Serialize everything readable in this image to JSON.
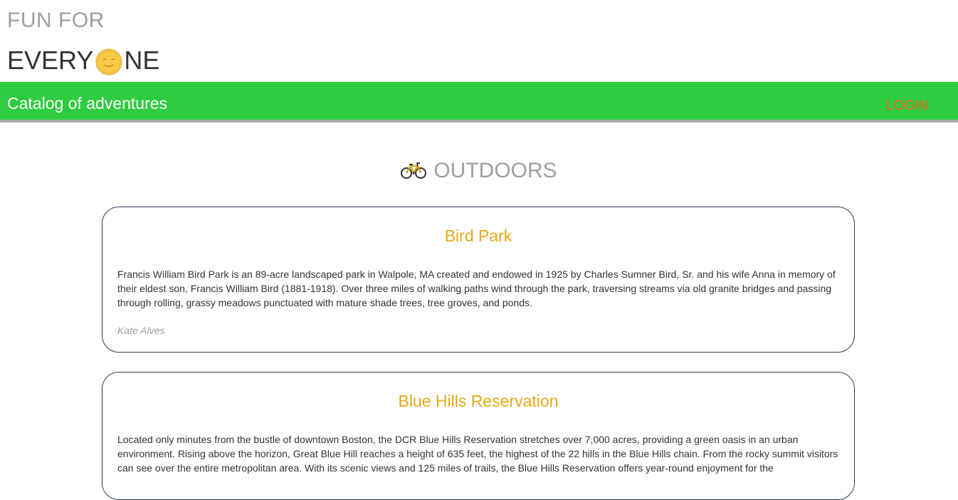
{
  "brand": {
    "line1": "FUN FOR",
    "line2_before": "EVERY",
    "line2_after": "NE",
    "logo_icon": "sun-smiley-icon"
  },
  "navbar": {
    "title": "Catalog of adventures",
    "login_label": "LOGIN",
    "bg_color": "#2ecc40",
    "login_color": "#ff5a1f"
  },
  "section": {
    "icon": "bicycle-icon",
    "title": "OUTDOORS"
  },
  "adventures": [
    {
      "title": "Bird Park",
      "description": "Francis William Bird Park is an 89-acre landscaped park in Walpole, MA created and endowed in 1925 by Charles Sumner Bird, Sr. and his wife Anna in memory of their eldest son, Francis William Bird (1881-1918). Over three miles of walking paths wind through the park, traversing streams via old granite bridges and passing through rolling, grassy meadows punctuated with mature shade trees, tree groves, and ponds.",
      "author": "Kate Alves"
    },
    {
      "title": "Blue Hills Reservation",
      "description": "Located only minutes from the bustle of downtown Boston, the DCR Blue Hills Reservation stretches over 7,000 acres, providing a green oasis in an urban environment. Rising above the horizon, Great Blue Hill reaches a height of 635 feet, the highest of the 22 hills in the Blue Hills chain. From the rocky summit visitors can see over the entire metropolitan area. With its scenic views and 125 miles of trails, the Blue Hills Reservation offers year-round enjoyment for the"
    }
  ],
  "colors": {
    "card_title": "#e6a817",
    "muted_text": "#9e9e9e"
  }
}
